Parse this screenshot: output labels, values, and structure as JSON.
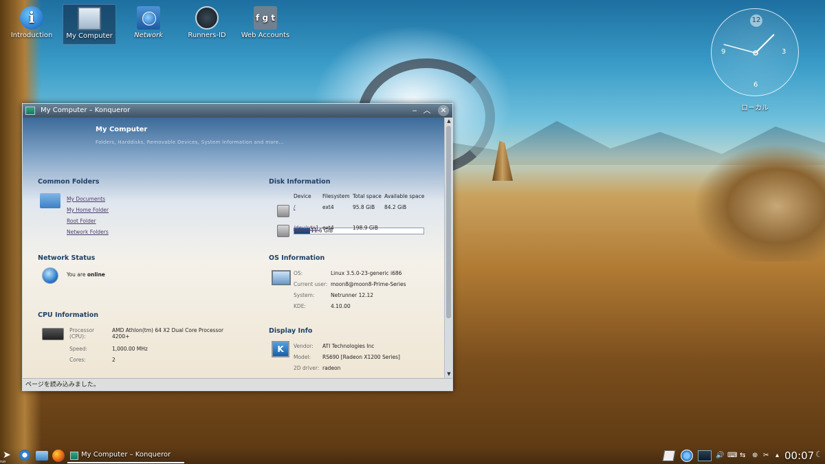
{
  "desktop": {
    "icons": [
      {
        "label": "Introduction",
        "icon": "info-icon"
      },
      {
        "label": "My Computer",
        "icon": "computer-icon"
      },
      {
        "label": "Network",
        "icon": "network-folder-icon"
      },
      {
        "label": "Runners-ID",
        "icon": "runners-id-icon"
      },
      {
        "label": "Web Accounts",
        "icon": "web-accounts-icon"
      }
    ]
  },
  "clock": {
    "numbers": {
      "n12": "12",
      "n3": "3",
      "n6": "6",
      "n9": "9"
    },
    "label": "ローカル",
    "hour_hand_angle_deg": 45,
    "minute_hand_angle_deg": 285
  },
  "window": {
    "title": "My Computer – Konqueror",
    "header": {
      "title": "My Computer",
      "subtitle": "Folders, Harddisks, Removable Devices, System Information and more..."
    },
    "common_folders": {
      "heading": "Common Folders",
      "links": [
        "My Documents",
        "My Home Folder",
        "Root Folder",
        "Network Folders"
      ]
    },
    "network_status": {
      "heading": "Network Status",
      "text_prefix": "You are ",
      "text_status": "online"
    },
    "cpu": {
      "heading": "CPU Information",
      "processor_label": "Processor (CPU):",
      "processor_value": "AMD Athlon(tm) 64 X2 Dual Core Processor 4200+",
      "speed_label": "Speed:",
      "speed_value": "1,000.00 MHz",
      "cores_label": "Cores:",
      "cores_value": "2"
    },
    "disk": {
      "heading": "Disk Information",
      "columns": [
        "Device",
        "Filesystem",
        "Total space",
        "Available space"
      ],
      "rows": [
        {
          "device": "/",
          "filesystem": "ext4",
          "total": "95.8 GiB",
          "available": "84.2 GiB"
        },
        {
          "device": "/dev/sda1",
          "filesystem": "ext4",
          "total": "198.9 GiB",
          "available": ""
        }
      ],
      "usage_bar_text": "11.6 GiB",
      "usage_fraction": 0.12
    },
    "os": {
      "heading": "OS Information",
      "os_label": "OS:",
      "os_value": "Linux 3.5.0-23-generic i686",
      "user_label": "Current user:",
      "user_value": "moon8@moon8-Prime-Series",
      "system_label": "System:",
      "system_value": "Netrunner 12.12",
      "kde_label": "KDE:",
      "kde_value": "4.10.00"
    },
    "display": {
      "heading": "Display Info",
      "vendor_label": "Vendor:",
      "vendor_value": "ATI Technologies Inc",
      "model_label": "Model:",
      "model_value": "RS690 [Radeon X1200 Series]",
      "driver_label": "2D driver:",
      "driver_value": "radeon"
    },
    "status": "ページを読み込みました。"
  },
  "panel": {
    "run_label": "run",
    "task_label": "My Computer – Konqueror",
    "time": "00:07"
  }
}
